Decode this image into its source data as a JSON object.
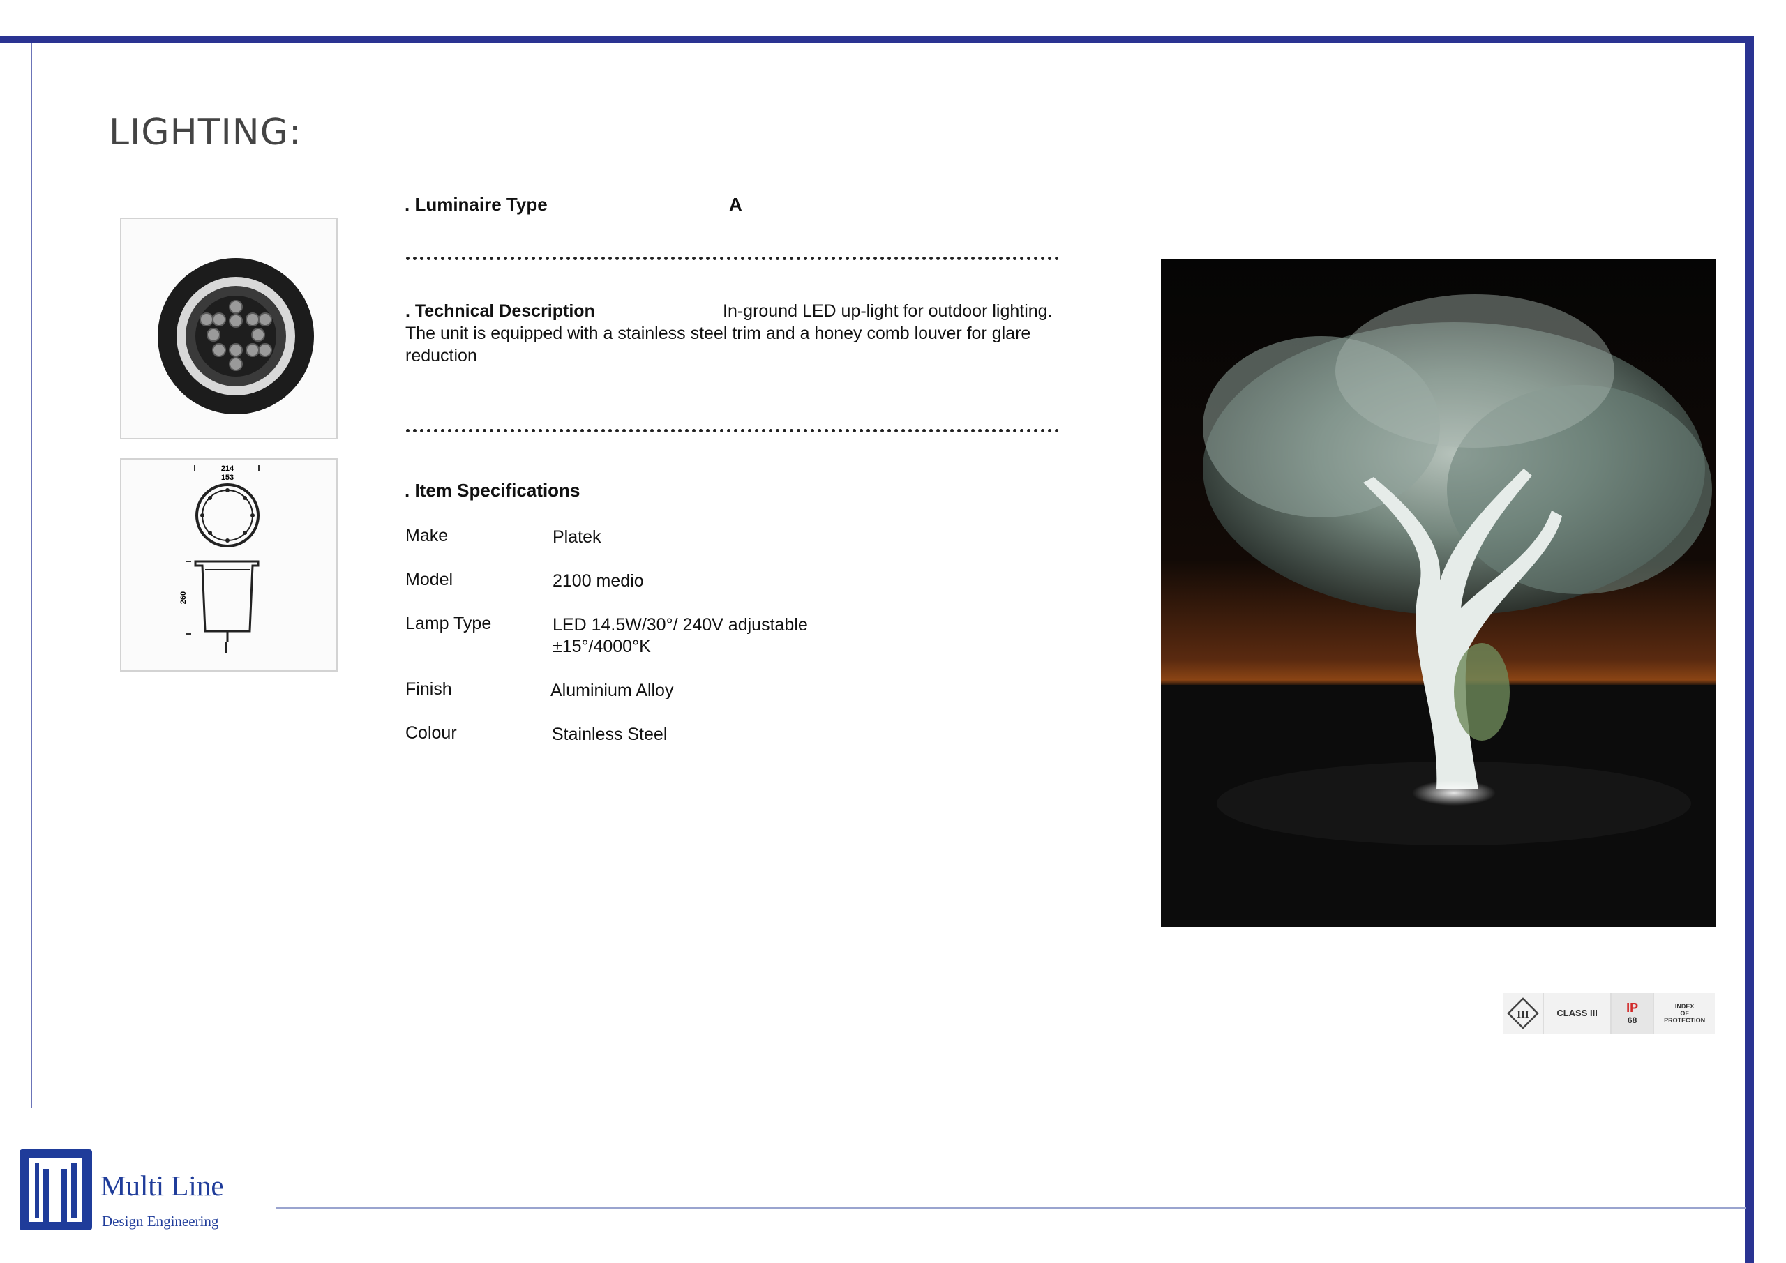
{
  "page": {
    "title": "LIGHTING:"
  },
  "luminaire": {
    "label": ". Luminaire Type",
    "value": "A"
  },
  "technical": {
    "label": ". Technical Description",
    "text_line1": "In-ground LED up-light for outdoor lighting.",
    "text_rest": "The unit is equipped with a stainless steel trim and a honey comb louver for glare reduction"
  },
  "drawing": {
    "dim_outer": "214",
    "dim_inner": "153",
    "dim_height": "260"
  },
  "specs": {
    "heading": ". Item Specifications",
    "rows": [
      {
        "label": "Make",
        "value": "Platek"
      },
      {
        "label": "Model",
        "value": "2100 medio"
      },
      {
        "label": "Lamp Type",
        "value": "LED 14.5W/30°/ 240V adjustable",
        "value2": "±15°/4000°K"
      },
      {
        "label": "Finish",
        "value": "Aluminium Alloy"
      },
      {
        "label": "Colour",
        "value": "Stainless Steel"
      }
    ]
  },
  "certification": {
    "class_symbol": "III",
    "class_label": "CLASS III",
    "ip_label": "IP",
    "ip_value": "68",
    "ip_desc_1": "INDEX",
    "ip_desc_2": "OF",
    "ip_desc_3": "PROTECTION"
  },
  "logo": {
    "name": "Multi Line",
    "subtitle": "Design Engineering"
  },
  "colors": {
    "frame": "#2a3392",
    "logo": "#1f3c9a",
    "ip_badge": "#d22a2a"
  }
}
